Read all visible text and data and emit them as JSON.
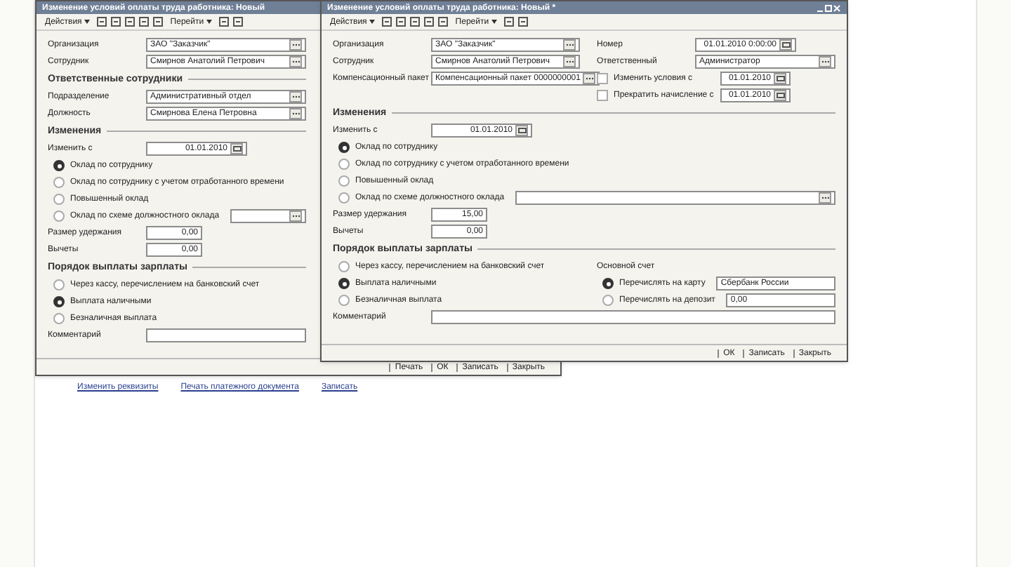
{
  "windows": [
    {
      "title": "Изменение условий оплаты труда работника: Новый",
      "toolbar": [
        {
          "kind": "menu",
          "label": "Действия"
        },
        {
          "kind": "icon"
        },
        {
          "kind": "icon"
        },
        {
          "kind": "icon"
        },
        {
          "kind": "icon"
        },
        {
          "kind": "icon"
        },
        {
          "kind": "menu",
          "label": "Перейти"
        },
        {
          "kind": "icon"
        },
        {
          "kind": "icon"
        }
      ],
      "body": [
        {
          "kind": "field",
          "label": "Организация",
          "value": "ЗАО \"Заказчик\""
        },
        {
          "kind": "field",
          "label": "Сотрудник",
          "value": "Смирнов Анатолий Петрович"
        },
        {
          "kind": "section",
          "label": "Ответственные сотрудники"
        },
        {
          "kind": "field",
          "label": "Подразделение",
          "value": "Административный отдел"
        },
        {
          "kind": "field",
          "label": "Должность",
          "value": "Смирнова Елена Петровна"
        },
        {
          "kind": "section",
          "label": "Изменения"
        },
        {
          "kind": "date",
          "label": "Изменить с",
          "value": "01.01.2010"
        },
        {
          "kind": "radio",
          "label": "Оклад по сотруднику",
          "selected": true
        },
        {
          "kind": "radio",
          "label": "Оклад по сотруднику с учетом отработанного времени",
          "selected": false
        },
        {
          "kind": "radio",
          "label": "Повышенный оклад",
          "selected": false
        },
        {
          "kind": "radio_combo",
          "label": "Оклад по схеме должностного оклада",
          "selected": false
        },
        {
          "kind": "number",
          "label": "Размер удержания",
          "value": "0,00"
        },
        {
          "kind": "number",
          "label": "Вычеты",
          "value": "0,00"
        },
        {
          "kind": "section",
          "label": "Порядок выплаты зарплаты"
        },
        {
          "kind": "radio",
          "label": "Через кассу, перечислением на банковский счет",
          "selected": false
        },
        {
          "kind": "radio",
          "label": "Выплата наличными",
          "selected": true
        },
        {
          "kind": "radio",
          "label": "Безналичная выплата",
          "selected": false
        },
        {
          "kind": "empty_field",
          "label": "Комментарий"
        }
      ],
      "buttons": [
        "Печать",
        "ОК",
        "Записать",
        "Закрыть"
      ]
    },
    {
      "title": "Изменение условий оплаты труда работника: Новый *",
      "toolbar": [
        {
          "kind": "menu",
          "label": "Действия"
        },
        {
          "kind": "icon"
        },
        {
          "kind": "icon"
        },
        {
          "kind": "icon"
        },
        {
          "kind": "icon"
        },
        {
          "kind": "icon"
        },
        {
          "kind": "menu",
          "label": "Перейти"
        },
        {
          "kind": "icon"
        },
        {
          "kind": "icon"
        }
      ],
      "body": [
        {
          "kind": "columns",
          "left": [
            {
              "kind": "field",
              "label": "Организация",
              "value": "ЗАО \"Заказчик\""
            },
            {
              "kind": "field",
              "label": "Сотрудник",
              "value": "Смирнов Анатолий Петрович"
            },
            {
              "kind": "field",
              "label": "Компенсационный пакет",
              "value": "Компенсационный пакет 0000000001"
            }
          ],
          "right": [
            {
              "kind": "date",
              "label": "Номер",
              "value": "01.01.2010 0:00:00"
            },
            {
              "kind": "field",
              "label": "Ответственный",
              "value": "Администратор"
            },
            {
              "kind": "check",
              "label": "Изменить условия с",
              "checked": false,
              "value": "01.01.2010"
            },
            {
              "kind": "check",
              "label": "Прекратить начисление с",
              "checked": false,
              "value": "01.01.2010"
            }
          ]
        },
        {
          "kind": "section",
          "label": "Изменения"
        },
        {
          "kind": "date",
          "label": "Изменить с",
          "value": "01.01.2010"
        },
        {
          "kind": "radio",
          "label": "Оклад по сотруднику",
          "selected": true
        },
        {
          "kind": "radio",
          "label": "Оклад по сотруднику с учетом отработанного времени",
          "selected": false
        },
        {
          "kind": "radio",
          "label": "Повышенный оклад",
          "selected": false
        },
        {
          "kind": "radio_combo",
          "label": "Оклад по схеме должностного оклада",
          "selected": false
        },
        {
          "kind": "number",
          "label": "Размер удержания",
          "value": "15,00"
        },
        {
          "kind": "number",
          "label": "Вычеты",
          "value": "0,00"
        },
        {
          "kind": "section",
          "label": "Порядок выплаты зарплаты"
        },
        {
          "kind": "columns",
          "left": [
            {
              "kind": "radio",
              "label": "Через кассу, перечислением на банковский счет",
              "selected": false
            },
            {
              "kind": "radio",
              "label": "Выплата наличными",
              "selected": true
            },
            {
              "kind": "radio",
              "label": "Безналичная выплата",
              "selected": false
            }
          ],
          "right": [
            {
              "kind": "text",
              "label": "Основной счет"
            },
            {
              "kind": "radio",
              "label": "Перечислять на карту",
              "selected": true,
              "value": "Сбербанк России"
            },
            {
              "kind": "radio",
              "label": "Перечислять на депозит",
              "selected": false,
              "value": "0,00"
            }
          ]
        },
        {
          "kind": "empty_field",
          "label": "Комментарий"
        }
      ],
      "buttons": [
        "ОК",
        "Записать",
        "Закрыть"
      ]
    }
  ],
  "links": [
    "Изменить реквизиты",
    "Печать платежного документа",
    "Записать"
  ]
}
